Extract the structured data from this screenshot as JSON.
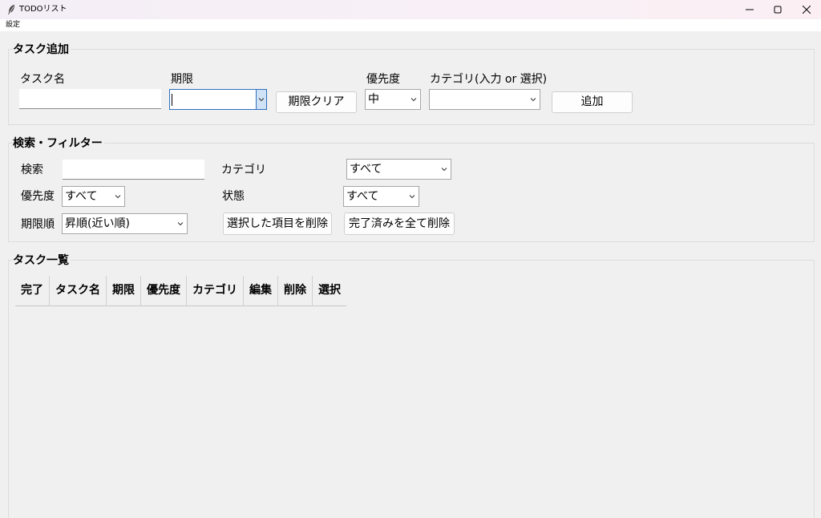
{
  "window": {
    "title": "TODOリスト",
    "icon": "feather-icon"
  },
  "menubar": {
    "items": [
      "設定"
    ]
  },
  "add_task": {
    "group_title": "タスク追加",
    "task_name_label": "タスク名",
    "task_name_value": "",
    "deadline_label": "期限",
    "deadline_value": "",
    "clear_deadline_button": "期限クリア",
    "priority_label": "優先度",
    "priority_value": "中",
    "category_label": "カテゴリ(入力 or 選択)",
    "category_value": "",
    "add_button": "追加"
  },
  "filter": {
    "group_title": "検索・フィルター",
    "search_label": "検索",
    "search_value": "",
    "category_label": "カテゴリ",
    "category_value": "すべて",
    "priority_label": "優先度",
    "priority_value": "すべて",
    "status_label": "状態",
    "status_value": "すべて",
    "sort_label": "期限順",
    "sort_value": "昇順(近い順)",
    "delete_selected_button": "選択した項目を削除",
    "delete_completed_button": "完了済みを全て削除"
  },
  "task_list": {
    "group_title": "タスク一覧",
    "columns": [
      "完了",
      "タスク名",
      "期限",
      "優先度",
      "カテゴリ",
      "編集",
      "削除",
      "選択"
    ],
    "rows": []
  },
  "colors": {
    "background": "#f0f0f0",
    "focus_border": "#2f6fbf",
    "focus_fill": "#cfe2f6"
  }
}
